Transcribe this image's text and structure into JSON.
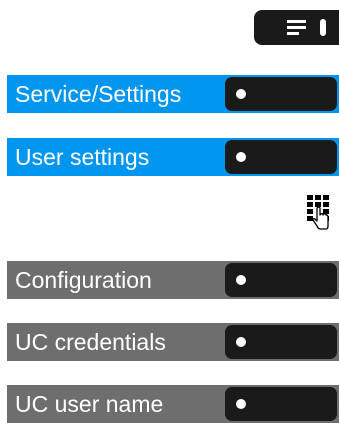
{
  "header": {
    "menu_key_icon": "menu-icon"
  },
  "rows": [
    {
      "label": "Service/Settings",
      "color": "#0096f0"
    },
    {
      "label": "User settings",
      "color": "#0096f0"
    },
    {
      "label": "Configuration",
      "color": "#6e6e6e"
    },
    {
      "label": "UC credentials",
      "color": "#6e6e6e"
    },
    {
      "label": "UC user name",
      "color": "#6e6e6e"
    }
  ],
  "hint": {
    "icon": "keypad-touch-icon"
  }
}
